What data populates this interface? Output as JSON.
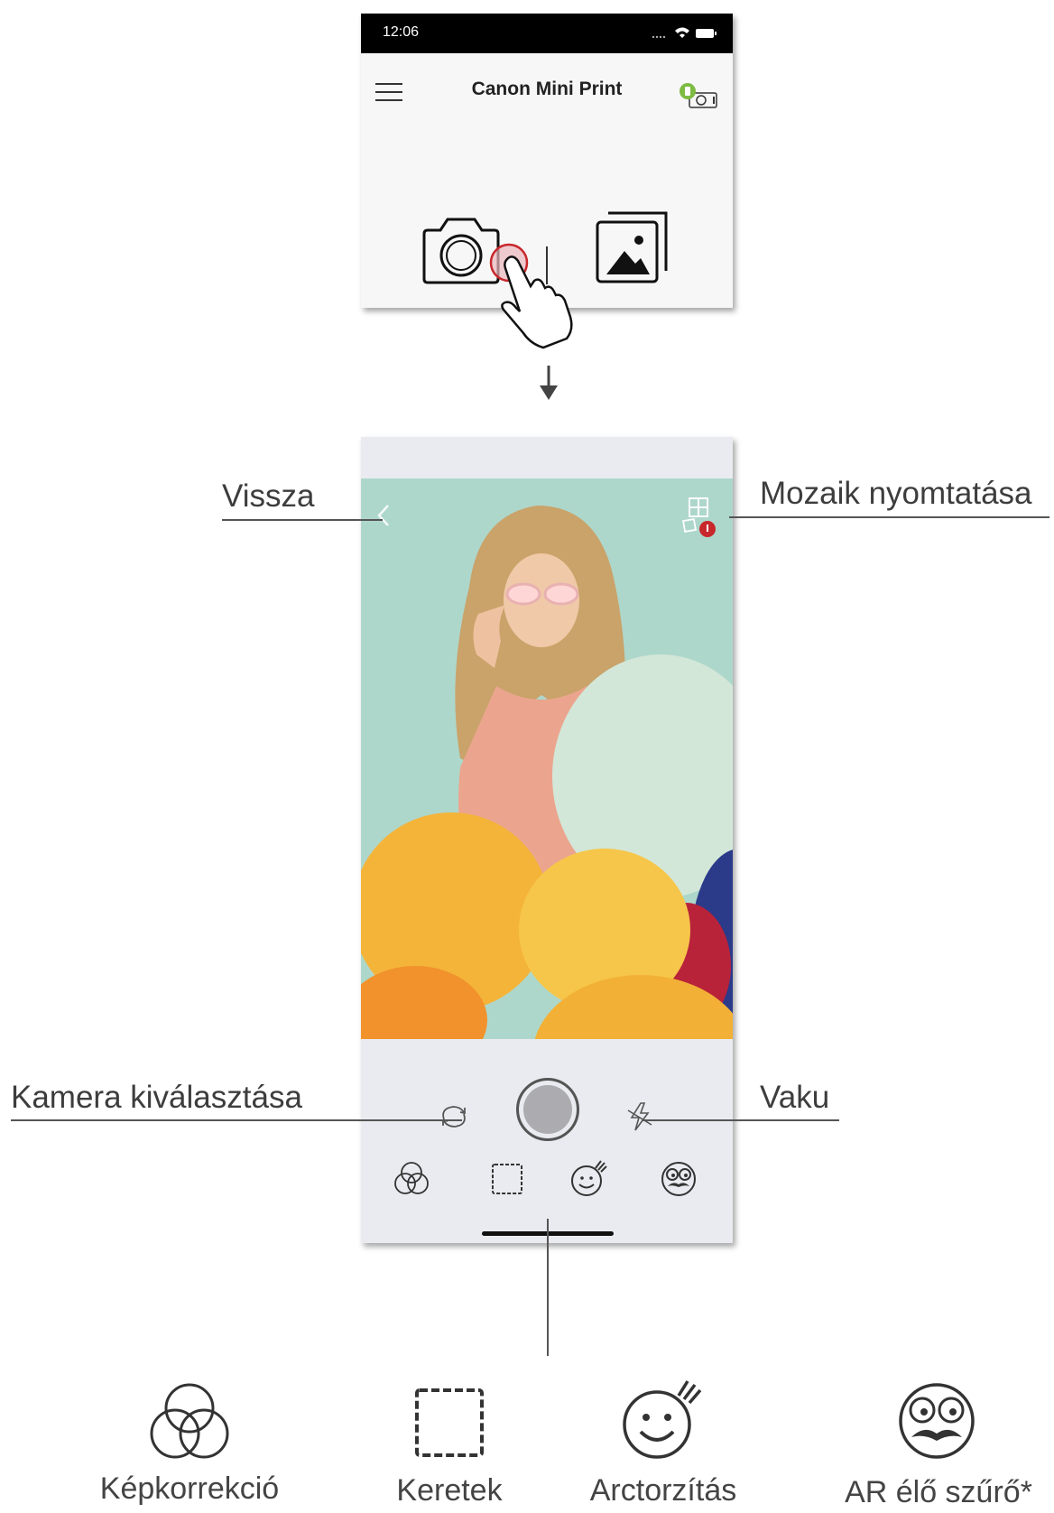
{
  "top_phone": {
    "status_time": "12:06",
    "app_title": "Canon Mini Print",
    "icons": [
      "menu-icon",
      "printer-status-icon",
      "camera-icon",
      "gallery-icon",
      "pointing-hand-icon"
    ]
  },
  "camera_screen": {
    "icons": [
      "back-icon",
      "collage-print-icon",
      "camera-switch-icon",
      "shutter-button",
      "flash-off-icon",
      "filter-icon",
      "frame-icon",
      "face-distortion-icon",
      "ar-filter-icon"
    ]
  },
  "callouts": {
    "back": "Vissza",
    "collage": "Mozaik nyomtatása",
    "camera_select": "Kamera kiválasztása",
    "flash": "Vaku"
  },
  "legend": [
    {
      "label": "Képkorrekció",
      "icon": "filter-icon"
    },
    {
      "label": "Keretek",
      "icon": "frame-icon"
    },
    {
      "label": "Arctorzítás",
      "icon": "face-distortion-icon"
    },
    {
      "label": "AR élő szűrő*",
      "icon": "ar-filter-icon"
    }
  ],
  "colors": {
    "accent_red": "#c8282c",
    "printer_green": "#7dbb42",
    "screen_bg": "#e9ebf0",
    "photo_bg": "#aed7cb"
  }
}
